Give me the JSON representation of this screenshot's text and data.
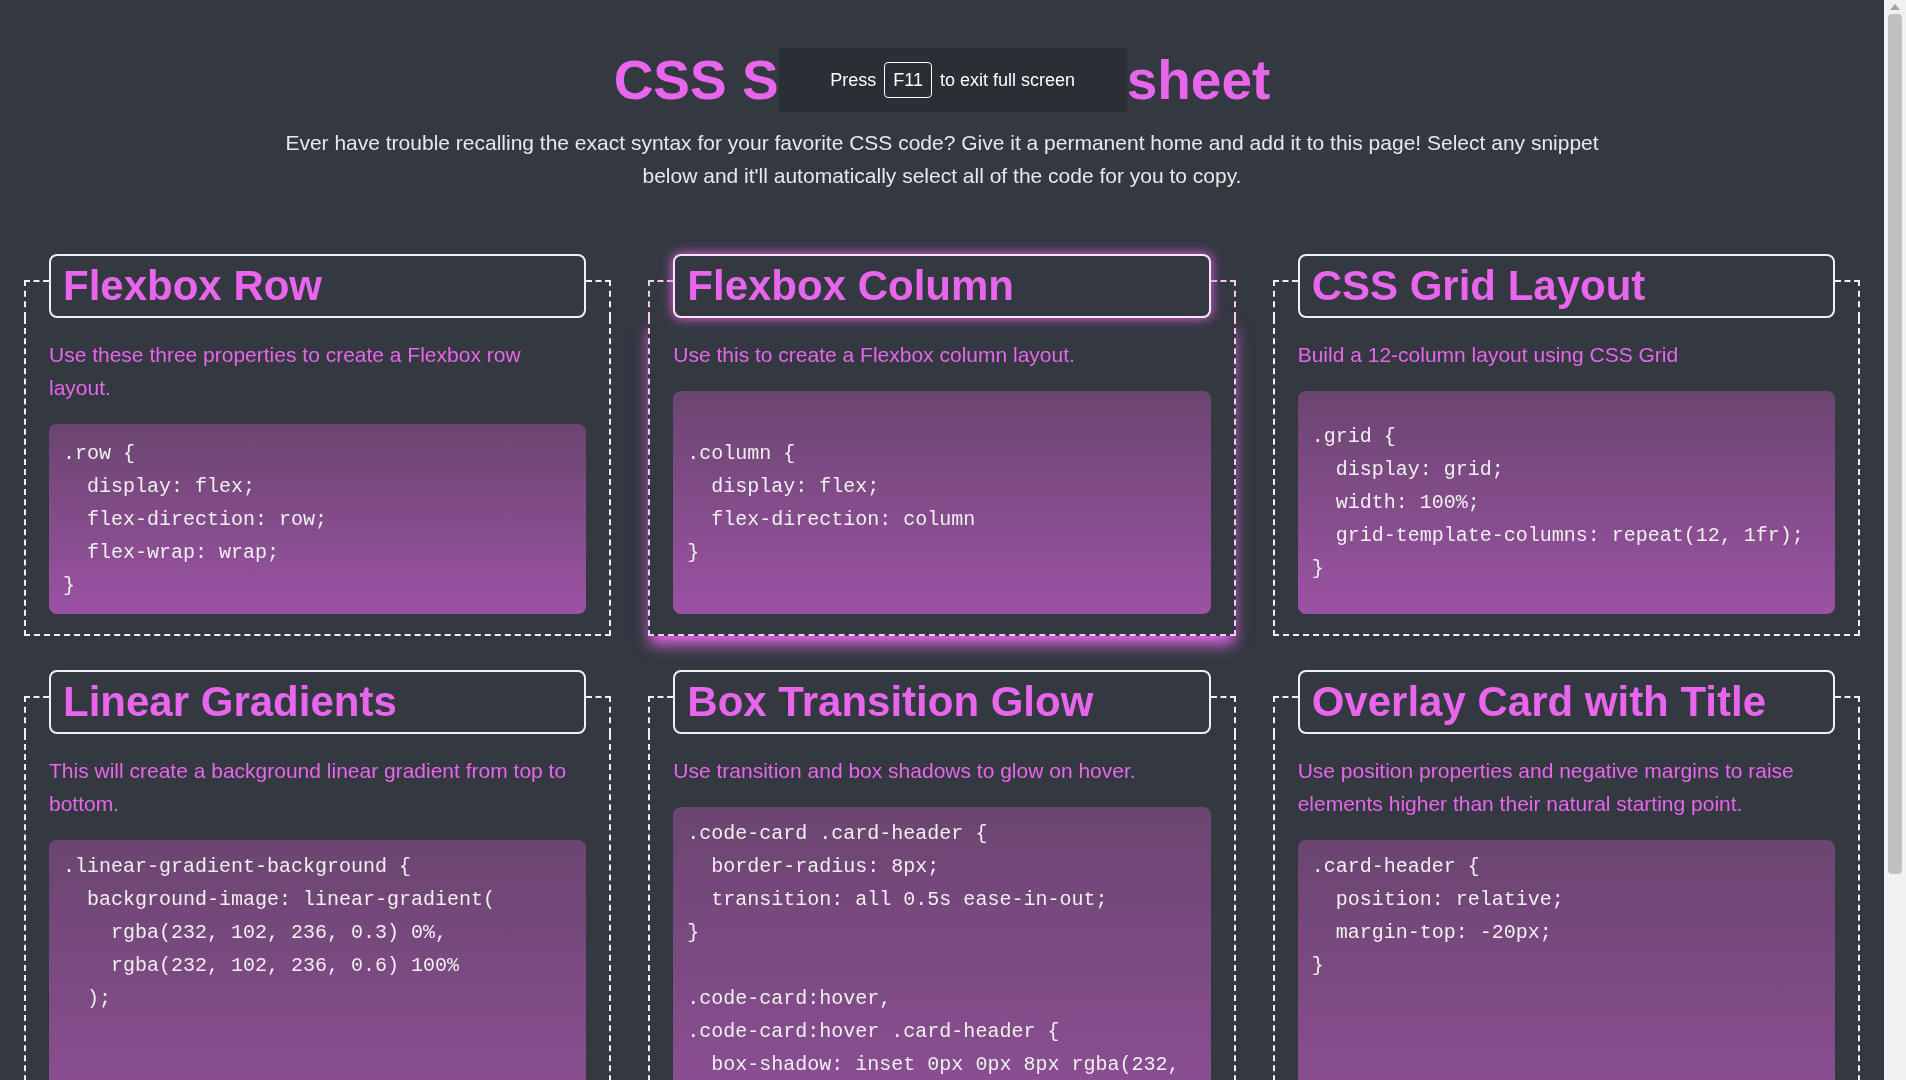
{
  "page": {
    "title_before": "CSS S",
    "title_after": "sheet",
    "subtitle": "Ever have trouble recalling the exact syntax for your favorite CSS code? Give it a permanent home and add it to this page! Select any snippet below and it'll automatically select all of the code for you to copy."
  },
  "fullscreen_notice": {
    "before": "Press",
    "key": "F11",
    "after": "to exit full screen"
  },
  "snippets": [
    {
      "title": "Flexbox Row",
      "description": "Use these three properties to create a Flexbox row layout.",
      "code": [
        [
          ".row {",
          "  display: flex;",
          "  flex-direction: row;",
          "  flex-wrap: wrap;",
          "}"
        ]
      ],
      "hovered": false
    },
    {
      "title": "Flexbox Column",
      "description": "Use this to create a Flexbox column layout.",
      "code": [
        [
          ".column {",
          "  display: flex;",
          "  flex-direction: column",
          "}"
        ]
      ],
      "hovered": true
    },
    {
      "title": "CSS Grid Layout",
      "description": "Build a 12-column layout using CSS Grid",
      "code": [
        [
          ".grid {",
          "  display: grid;",
          "  width: 100%;",
          "  grid-template-columns: repeat(12, 1fr);",
          "}"
        ]
      ],
      "hovered": false
    },
    {
      "title": "Linear Gradients",
      "description": "This will create a background linear gradient from top to bottom.",
      "code": [
        [
          ".linear-gradient-background {",
          "  background-image: linear-gradient(",
          "    rgba(232, 102, 236, 0.3) 0%,",
          "    rgba(232, 102, 236, 0.6) 100%",
          "  );"
        ]
      ],
      "hovered": false
    },
    {
      "title": "Box Transition Glow",
      "description": "Use transition and box shadows to glow on hover.",
      "code": [
        [
          ".code-card .card-header {",
          "  border-radius: 8px;",
          "  transition: all 0.5s ease-in-out;",
          "}"
        ],
        [
          ".code-card:hover,",
          ".code-card:hover .card-header {",
          "  box-shadow: inset 0px 0px 8px rgba(232,"
        ]
      ],
      "hovered": false
    },
    {
      "title": "Overlay Card with Title",
      "description": "Use position properties and negative margins to raise elements higher than their natural starting point.",
      "code": [
        [
          ".card-header {",
          "  position: relative;",
          "  margin-top: -20px;",
          "}"
        ]
      ],
      "hovered": false
    }
  ]
}
